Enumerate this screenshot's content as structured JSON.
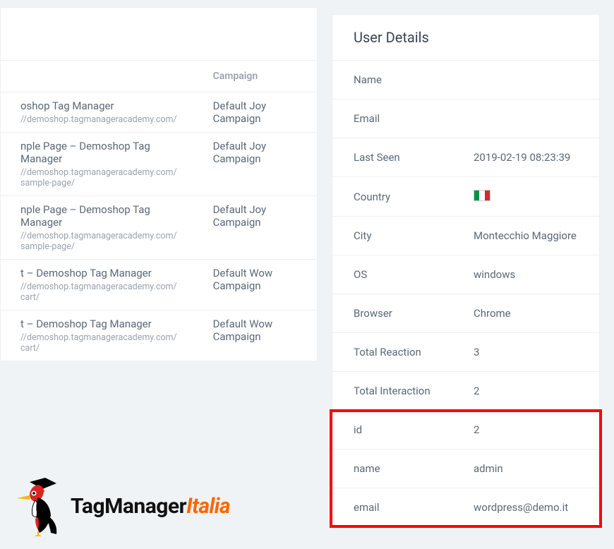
{
  "activity": {
    "headers": {
      "page": "",
      "campaign": "Campaign"
    },
    "rows": [
      {
        "title": "oshop Tag Manager",
        "url": "//demoshop.tagmanageracademy.com/",
        "campaign": "Default Joy Campaign"
      },
      {
        "title": "nple Page – Demoshop Tag Manager",
        "url": "//demoshop.tagmanageracademy.com/sample-page/",
        "campaign": "Default Joy Campaign"
      },
      {
        "title": "nple Page – Demoshop Tag Manager",
        "url": "//demoshop.tagmanageracademy.com/sample-page/",
        "campaign": "Default Joy Campaign"
      },
      {
        "title": "t – Demoshop Tag Manager",
        "url": "//demoshop.tagmanageracademy.com/cart/",
        "campaign": "Default Wow Campaign"
      },
      {
        "title": "t – Demoshop Tag Manager",
        "url": "//demoshop.tagmanageracademy.com/cart/",
        "campaign": "Default Wow Campaign"
      }
    ]
  },
  "details": {
    "title": "User Details",
    "rows": [
      {
        "label": "Name",
        "value": ""
      },
      {
        "label": "Email",
        "value": ""
      },
      {
        "label": "Last Seen",
        "value": "2019-02-19 08:23:39"
      },
      {
        "label": "Country",
        "value": "flag-it",
        "flag": true
      },
      {
        "label": "City",
        "value": "Montecchio Maggiore"
      },
      {
        "label": "OS",
        "value": "windows"
      },
      {
        "label": "Browser",
        "value": "Chrome"
      },
      {
        "label": "Total Reaction",
        "value": "3"
      },
      {
        "label": "Total Interaction",
        "value": "2"
      },
      {
        "label": "id",
        "value": "2",
        "hl": true
      },
      {
        "label": "name",
        "value": "admin",
        "hl": true
      },
      {
        "label": "email",
        "value": "wordpress@demo.it",
        "hl": true
      }
    ]
  },
  "logo": {
    "part1": "TagManager",
    "part2": "Italia"
  }
}
